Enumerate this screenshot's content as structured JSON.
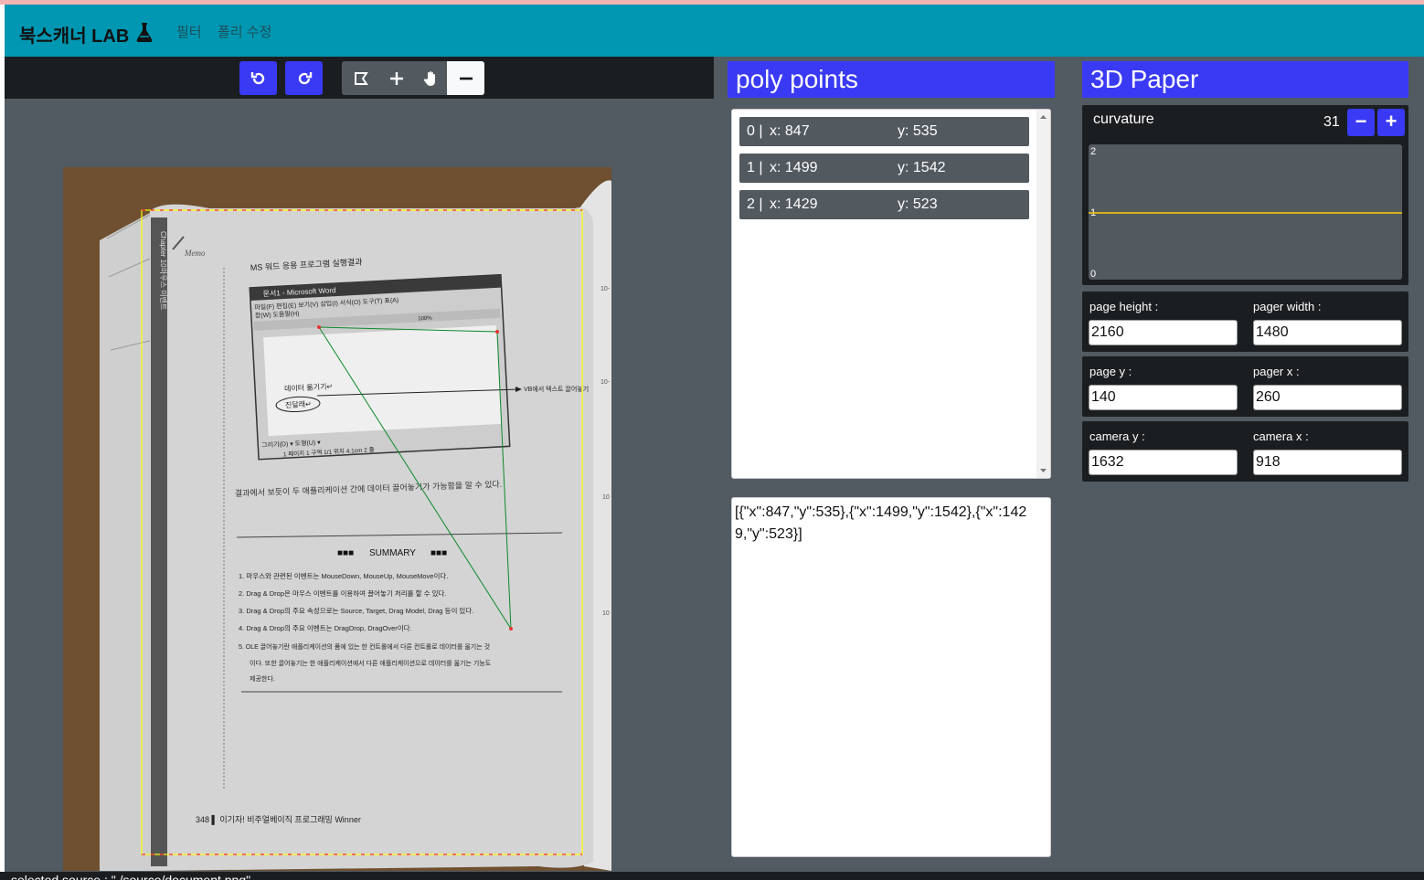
{
  "header": {
    "brand": "북스캐너 LAB",
    "brand_icon": "flask-icon",
    "nav": [
      "필터",
      "폴리 수정"
    ]
  },
  "toolbar": {
    "buttons": [
      "undo-icon",
      "redo-icon",
      "polygon-select-icon",
      "plus-icon",
      "hand-icon",
      "minus-icon"
    ]
  },
  "photo_page": {
    "chapter": "Chapter 10",
    "side_title": "마우스 이벤트",
    "memo": "Memo",
    "section_title": "MS 워드 응용 프로그램 실행결과",
    "window_title": "문서1 - Microsoft Word",
    "menu": "파일(F)  편집(E)  보기(V)  삽입(I)  서식(O)  도구(T)  표(A)",
    "menu2": "창(W)  도움말(H)",
    "zoom": "100%",
    "doc_line1": "데이터 옮기기↵",
    "doc_line2": "진달래↵",
    "annotation": "VB에서 텍스트 끌어놓기",
    "draw_bar": "그리기(D) ▾  도형(U) ▾",
    "status": "1 페이지     1 구역     1/1     위치 4.1cm     2 줄",
    "caption": "결과에서 보듯이 두 애플리케이션 간에 데이터 끌어놓기가 가능함을 알 수 있다.",
    "summary_title": "SUMMARY",
    "summary": [
      "1. 마우스와 관련된 이벤트는 MouseDown, MouseUp, MouseMove이다.",
      "2. Drag & Drop은 마우스 이벤트를 이용하여 끌어놓기 처리를 할 수 있다.",
      "3. Drag & Drop의 주요 속성으로는 Source, Target, Drag Model, Drag 등이 있다.",
      "4. Drag & Drop의 주요 이벤트는 DragDrop, DragOver이다.",
      "5. OLE 끌어놓기란 애플리케이션의 폼에 있는 한 컨트롤에서 다른 컨트롤로 데이터를 옮기는 것",
      "이다. 또한 끌어놓기는 한 애플리케이션에서 다른 애플리케이션으로 데이터를 옮기는 기능도",
      "제공한다."
    ],
    "footer": "348 ▌ 이기자! 비주얼베이직 프로그래밍 Winner"
  },
  "poly_panel": {
    "title": "poly points",
    "points": [
      {
        "index": "0 |",
        "x": "x: 847",
        "y": "y: 535"
      },
      {
        "index": "1 |",
        "x": "x: 1499",
        "y": "y: 1542"
      },
      {
        "index": "2 |",
        "x": "x: 1429",
        "y": "y: 523"
      }
    ],
    "json_text": "[{\"x\":847,\"y\":535},{\"x\":1499,\"y\":1542},{\"x\":1429,\"y\":523}]"
  },
  "paper_panel": {
    "title": "3D Paper",
    "curvature_label": "curvature",
    "curvature_value": "31",
    "minus_label": "−",
    "plus_label": "+",
    "graph_ticks": [
      "2",
      "1",
      "0"
    ],
    "graph_line_value": 1,
    "graph_line_color": "#ffcc00",
    "fields": [
      {
        "left_label": "page height :",
        "left_value": "2160",
        "right_label": "pager width :",
        "right_value": "1480"
      },
      {
        "left_label": "page y :",
        "left_value": "140",
        "right_label": "pager x :",
        "right_value": "260"
      },
      {
        "left_label": "camera y :",
        "left_value": "1632",
        "right_label": "camera x :",
        "right_value": "918"
      }
    ]
  },
  "statusbar": {
    "text": "selected source : \"./source/document.png\""
  },
  "colors": {
    "navbar": "#0097b2",
    "accent": "#3a3af5",
    "panel_dark": "#1b1e21",
    "workspace": "#525a62"
  }
}
